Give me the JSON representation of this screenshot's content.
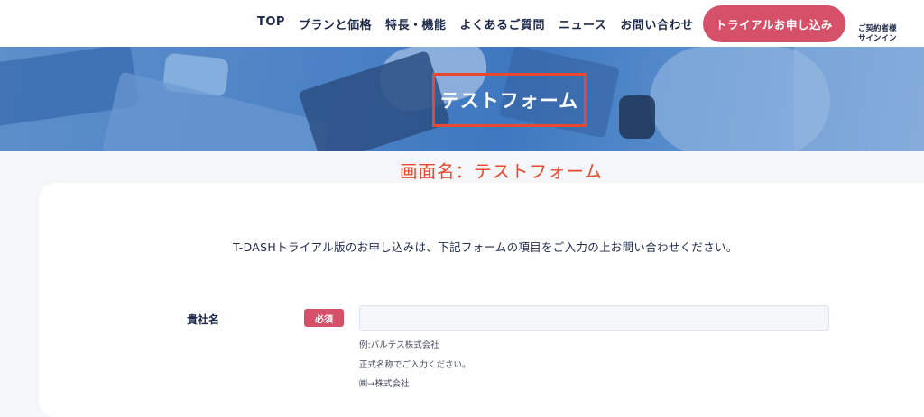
{
  "header": {
    "nav": [
      {
        "label": "TOP"
      },
      {
        "label": "プランと価格"
      },
      {
        "label": "特長・機能"
      },
      {
        "label": "よくあるご質問"
      },
      {
        "label": "ニュース"
      },
      {
        "label": "お問い合わせ"
      }
    ],
    "cta_label": "トライアルお申し込み",
    "signin_line1": "ご契約者様",
    "signin_line2": "サインイン"
  },
  "hero": {
    "title": "テストフォーム"
  },
  "annotation": "画面名：テストフォーム",
  "form": {
    "intro": "T-DASHトライアル版のお申し込みは、下記フォームの項目をご入力の上お問い合わせください。",
    "fields": [
      {
        "label": "貴社名",
        "badge": "必須",
        "value": "",
        "placeholder": "",
        "hints": [
          "例:バルテス株式会社",
          "正式名称でご入力ください。",
          "㈱→株式会社"
        ]
      }
    ]
  },
  "colors": {
    "accent": "#d6506a",
    "annotation": "#e8492e",
    "text": "#1e2a4a"
  }
}
